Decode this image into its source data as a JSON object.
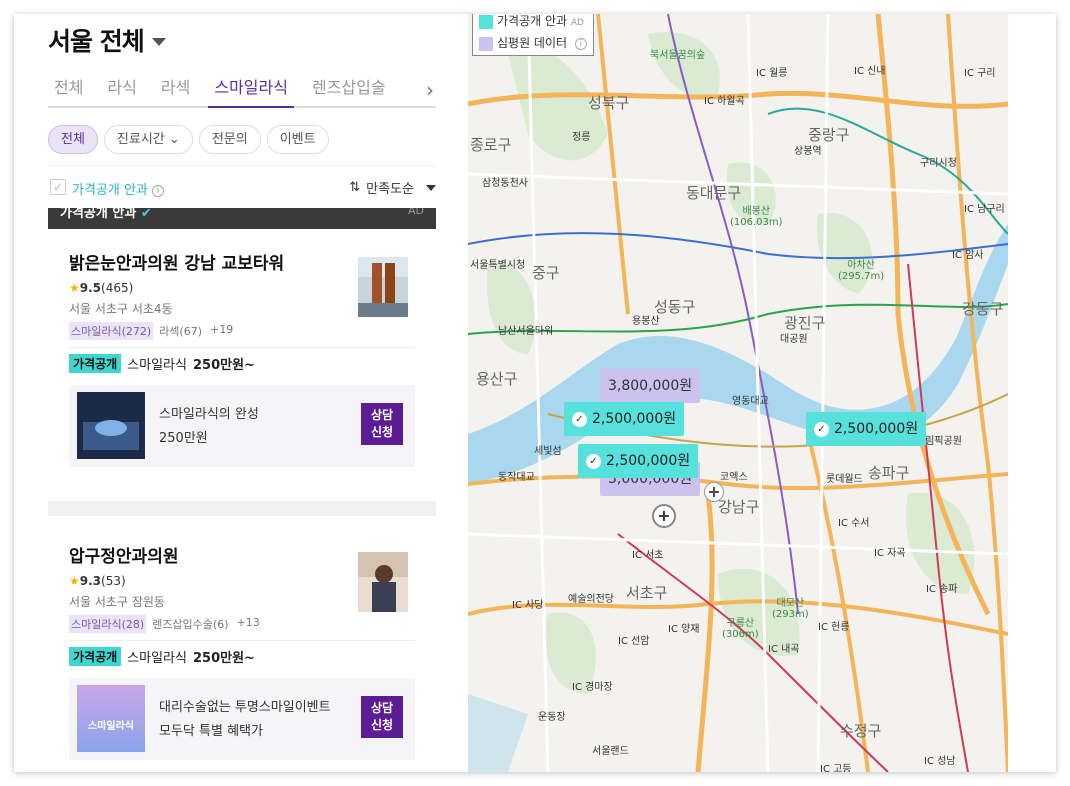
{
  "region": {
    "title": "서울 전체"
  },
  "tabs": [
    "전체",
    "라식",
    "라섹",
    "스마일라식",
    "렌즈삽입술"
  ],
  "active_tab": "스마일라식",
  "chips": [
    "전체",
    "진료시간",
    "전문의",
    "이벤트"
  ],
  "filter": {
    "price_open_label": "가격공개 안과",
    "sort_label": "만족도순"
  },
  "ad_bar": {
    "title": "가격공개 안과",
    "ad": "AD"
  },
  "clinics": [
    {
      "name": "밝은눈안과의원 강남 교보타워",
      "rating": "9.5",
      "reviews": "(465)",
      "address": "서울 서초구 서초4동",
      "tags": [
        "스마일라식(272)",
        "라섹(67)",
        "+19"
      ],
      "price_badge": "가격공개",
      "price_item": "스마일라식",
      "price_value": "250만원~",
      "promo_line1": "스마일라식의 완성",
      "promo_line2": "250만원",
      "promo_img_text": "스마일라식의 완성",
      "consult": "상담\n신청"
    },
    {
      "name": "압구정안과의원",
      "rating": "9.3",
      "reviews": "(53)",
      "address": "서울 서초구 잠원동",
      "tags": [
        "스마일라식(28)",
        "렌즈삽입수술(6)",
        "+13"
      ],
      "price_badge": "가격공개",
      "price_item": "스마일라식",
      "price_value": "250만원~",
      "promo_line1": "대리수술없는 투명스마일이벤트",
      "promo_line2": "모두닥 특별 혜택가",
      "promo_img_text": "스마일라식",
      "consult": "상담\n신청"
    }
  ],
  "map": {
    "legend": [
      {
        "label": "가격공개 안과",
        "ad": "AD",
        "color": "#56e1dc"
      },
      {
        "label": "심평원 데이터",
        "color": "#cbc3ee"
      }
    ],
    "pins": [
      {
        "label": "3,800,000원",
        "kind": "lav"
      },
      {
        "label": "2,500,000원",
        "kind": "cyan"
      },
      {
        "label": "2,500,000원",
        "kind": "cyan"
      },
      {
        "label": "3,000,000원",
        "kind": "lav"
      },
      {
        "label": "2,500,000원",
        "kind": "cyan"
      }
    ],
    "districts": [
      "성북구",
      "종로구",
      "동대문구",
      "중랑구",
      "중구",
      "성동구",
      "광진구",
      "용산구",
      "강동구",
      "강남구",
      "송파구",
      "서초구",
      "수정구"
    ],
    "places": [
      "북서울꿈의숲",
      "정릉",
      "삼청동천사",
      "서울특별시청",
      "남산서울타워",
      "용봉산",
      "세빛섬",
      "동작대교",
      "코엑스",
      "롯데월드",
      "예술의전당",
      "상봉역",
      "구리시청",
      "대공원",
      "올림픽공원",
      "서울랜드",
      "운동장",
      "영동대교"
    ],
    "mountains": [
      {
        "name": "배봉산",
        "height": "(106.03m)"
      },
      {
        "name": "아차산",
        "height": "(295.7m)"
      },
      {
        "name": "대모산",
        "height": "(293m)"
      },
      {
        "name": "구룡산",
        "height": "(306m)"
      }
    ],
    "ic": [
      "IC 월릉",
      "IC 신내",
      "IC 하월곡",
      "IC 구리",
      "IC 남구리",
      "IC 암사",
      "IC 수서",
      "IC 서초",
      "IC 자곡",
      "IC 사당",
      "IC 양재",
      "IC 헌릉",
      "IC 선암",
      "IC 내곡",
      "IC 경마장",
      "IC 송파",
      "IC 고등",
      "IC 성남"
    ],
    "roads": [
      "47",
      "6",
      "43",
      "100",
      "342",
      "1",
      "3"
    ]
  }
}
